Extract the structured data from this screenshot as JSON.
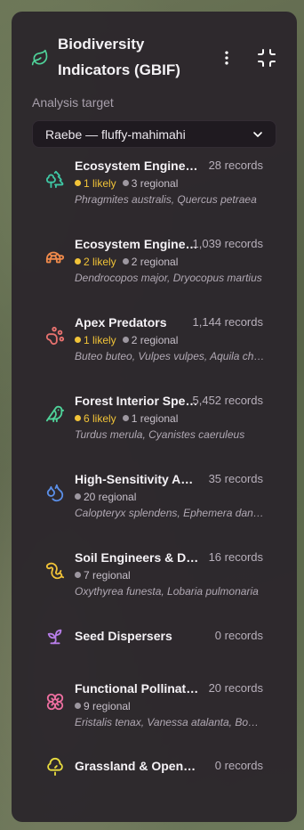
{
  "header": {
    "title_line1": "Biodiversity",
    "title_line2": "Indicators (GBIF)"
  },
  "analysis": {
    "label": "Analysis target",
    "selected": "Raebe — fluffy-mahimahi"
  },
  "colors": {
    "accent_green": "#4fd39a",
    "likely": "#f1c338",
    "regional": "#9d97a0"
  },
  "indicators": [
    {
      "name": "Ecosystem Engineers",
      "count": "28 records",
      "likely": "1 likely",
      "regional": "3 regional",
      "species": "Phragmites australis, Quercus petraea",
      "icon": "tree-icon",
      "color": "#3fc7a4"
    },
    {
      "name": "Ecosystem Engineers (Fauna)",
      "count": "1,039 records",
      "likely": "2 likely",
      "regional": "2 regional",
      "species": "Dendrocopos major, Dryocopus martius",
      "icon": "turtle-icon",
      "color": "#f08a4b"
    },
    {
      "name": "Apex Predators",
      "count": "1,144 records",
      "likely": "1 likely",
      "regional": "2 regional",
      "species": "Buteo buteo, Vulpes vulpes, Aquila chrysaetos",
      "icon": "paw-icon",
      "color": "#e8726f"
    },
    {
      "name": "Forest Interior Specialists",
      "count": "5,452 records",
      "likely": "6 likely",
      "regional": "1 regional",
      "species": "Turdus merula, Cyanistes caeruleus",
      "icon": "bird-icon",
      "color": "#4fd39a"
    },
    {
      "name": "High-Sensitivity Aquatic",
      "count": "35 records",
      "likely": "",
      "regional": "20 regional",
      "species": "Calopteryx splendens, Ephemera danica",
      "icon": "droplets-icon",
      "color": "#5b8fe8"
    },
    {
      "name": "Soil Engineers & Decomposers",
      "count": "16 records",
      "likely": "",
      "regional": "7 regional",
      "species": "Oxythyrea funesta, Lobaria pulmonaria",
      "icon": "worm-icon",
      "color": "#f1c338"
    },
    {
      "name": "Seed Dispersers",
      "count": "0 records",
      "likely": "",
      "regional": "",
      "species": "",
      "icon": "sprout-icon",
      "color": "#b77de8"
    },
    {
      "name": "Functional Pollinators",
      "count": "20 records",
      "likely": "",
      "regional": "9 regional",
      "species": "Eristalis tenax, Vanessa atalanta, Bombus",
      "icon": "flower-icon",
      "color": "#ee6fa0"
    },
    {
      "name": "Grassland & Open Habitat",
      "count": "0 records",
      "likely": "",
      "regional": "",
      "species": "",
      "icon": "tree-round-icon",
      "color": "#e8dc3f"
    }
  ]
}
